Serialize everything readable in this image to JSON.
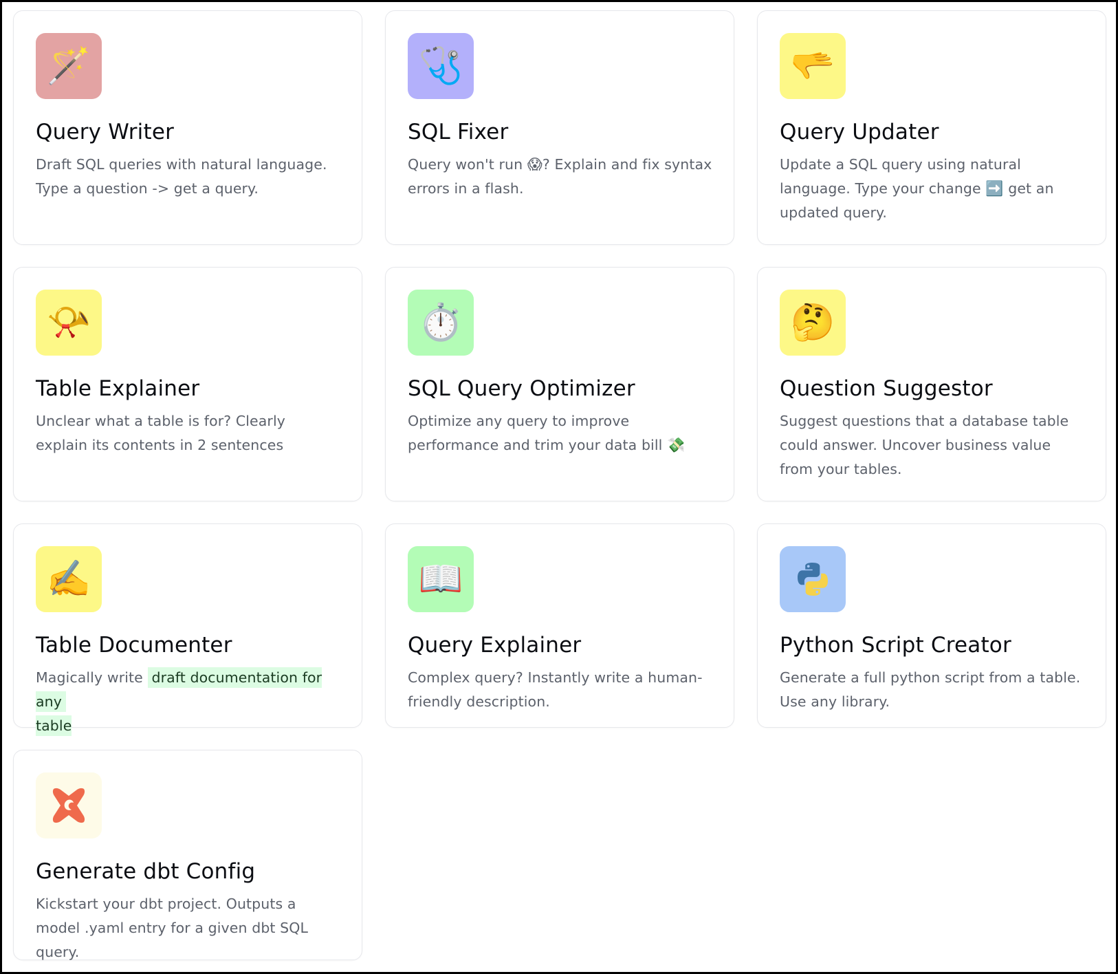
{
  "cards": [
    {
      "title": "Query Writer",
      "icon": "magic-wand-icon",
      "icon_bg": "#e3a3a3",
      "icon_glyph": "🪄",
      "desc": "Draft SQL queries with natural language. Type a question -> get a query."
    },
    {
      "title": "SQL Fixer",
      "icon": "stethoscope-icon",
      "icon_bg": "#b3b0fb",
      "icon_glyph": "🩺",
      "desc_parts": [
        "Query won't run ",
        "😱",
        "? Explain and fix syntax errors in a flash."
      ]
    },
    {
      "title": "Query Updater",
      "icon": "pointing-hand-icon",
      "icon_bg": "#fdf887",
      "icon_glyph": "🫳",
      "desc_parts": [
        "Update a SQL query using natural language. Type your change ",
        "➡️",
        " get an updated query."
      ]
    },
    {
      "title": "Table Explainer",
      "icon": "postal-horn-icon",
      "icon_bg": "#fdf887",
      "icon_glyph": "📯",
      "desc": "Unclear what a table is for? Clearly explain its contents in 2 sentences"
    },
    {
      "title": "SQL Query Optimizer",
      "icon": "stopwatch-icon",
      "icon_bg": "#b3fcb6",
      "icon_glyph": "⏱️",
      "desc_parts": [
        "Optimize any query to improve performance and trim your data bill ",
        "💸"
      ]
    },
    {
      "title": "Question Suggestor",
      "icon": "thinking-face-icon",
      "icon_bg": "#fdf887",
      "icon_glyph": "🤔",
      "desc": "Suggest questions that a database table could answer. Uncover business value from your tables."
    },
    {
      "title": "Table Documenter",
      "icon": "writing-hand-icon",
      "icon_bg": "#fdf887",
      "icon_glyph": "✍️",
      "desc_prefix": "Magically write ",
      "desc_highlight_1": "draft documentation for any",
      "desc_highlight_2": "table"
    },
    {
      "title": "Query Explainer",
      "icon": "open-book-icon",
      "icon_bg": "#b3fcb6",
      "icon_glyph": "📖",
      "desc": "Complex query? Instantly write a human-friendly description."
    },
    {
      "title": "Python Script Creator",
      "icon": "python-logo-icon",
      "icon_bg": "#a8c8f8",
      "desc": "Generate a full python script from a table. Use any library."
    },
    {
      "title": "Generate dbt Config",
      "icon": "dbt-logo-icon",
      "icon_bg": "#fefbe8",
      "desc": "Kickstart your dbt project. Outputs a model .yaml entry for a given dbt SQL query."
    }
  ],
  "colors": {
    "title": "#0b0d12",
    "desc": "#5c616b",
    "highlight_bg": "#dcfce3",
    "card_border": "#e6e7eb"
  }
}
